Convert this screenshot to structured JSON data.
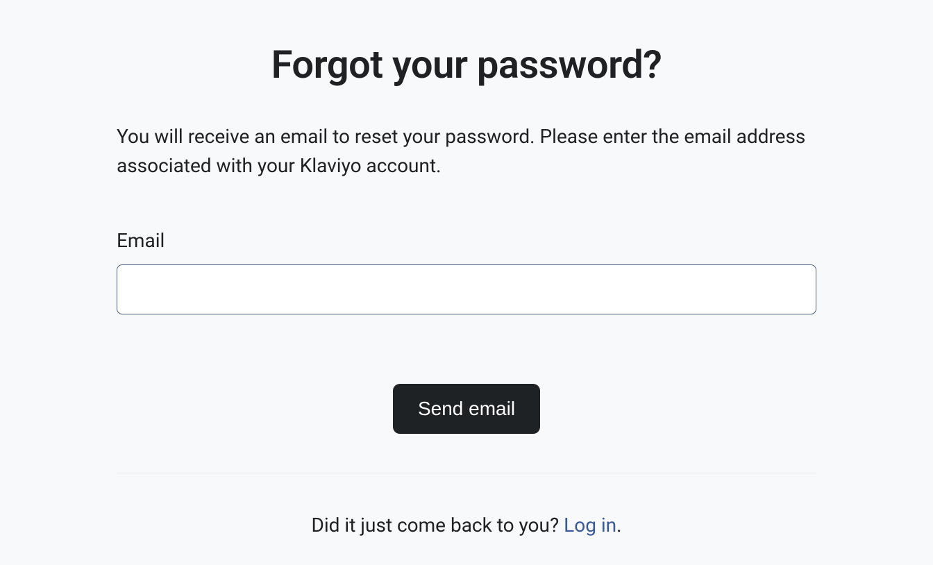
{
  "title": "Forgot your password?",
  "description": "You will receive an email to reset your password. Please enter the email address associated with your Klaviyo account.",
  "form": {
    "emailLabel": "Email",
    "emailValue": "",
    "submitLabel": "Send email"
  },
  "footer": {
    "prompt": "Did it just come back to you? ",
    "linkText": "Log in",
    "suffix": "."
  }
}
